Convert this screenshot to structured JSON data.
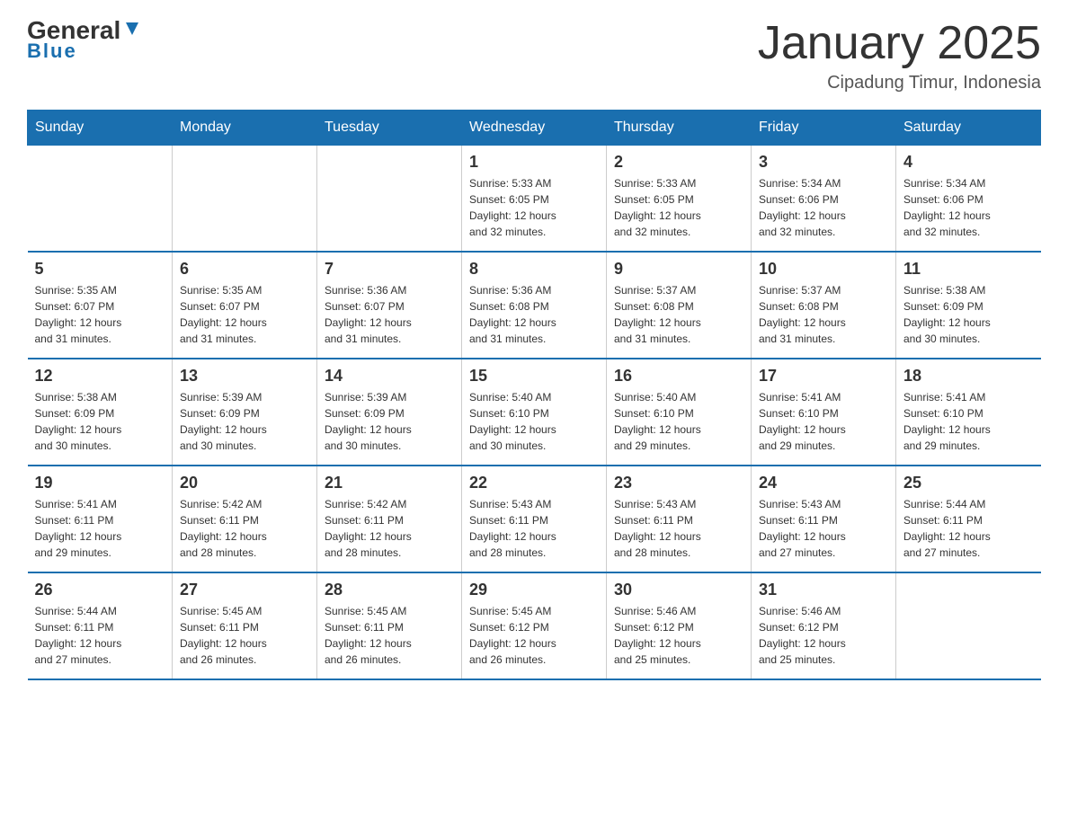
{
  "header": {
    "logo_general": "General",
    "logo_blue": "Blue",
    "title": "January 2025",
    "location": "Cipadung Timur, Indonesia"
  },
  "days_of_week": [
    "Sunday",
    "Monday",
    "Tuesday",
    "Wednesday",
    "Thursday",
    "Friday",
    "Saturday"
  ],
  "weeks": [
    [
      {
        "day": "",
        "info": ""
      },
      {
        "day": "",
        "info": ""
      },
      {
        "day": "",
        "info": ""
      },
      {
        "day": "1",
        "info": "Sunrise: 5:33 AM\nSunset: 6:05 PM\nDaylight: 12 hours\nand 32 minutes."
      },
      {
        "day": "2",
        "info": "Sunrise: 5:33 AM\nSunset: 6:05 PM\nDaylight: 12 hours\nand 32 minutes."
      },
      {
        "day": "3",
        "info": "Sunrise: 5:34 AM\nSunset: 6:06 PM\nDaylight: 12 hours\nand 32 minutes."
      },
      {
        "day": "4",
        "info": "Sunrise: 5:34 AM\nSunset: 6:06 PM\nDaylight: 12 hours\nand 32 minutes."
      }
    ],
    [
      {
        "day": "5",
        "info": "Sunrise: 5:35 AM\nSunset: 6:07 PM\nDaylight: 12 hours\nand 31 minutes."
      },
      {
        "day": "6",
        "info": "Sunrise: 5:35 AM\nSunset: 6:07 PM\nDaylight: 12 hours\nand 31 minutes."
      },
      {
        "day": "7",
        "info": "Sunrise: 5:36 AM\nSunset: 6:07 PM\nDaylight: 12 hours\nand 31 minutes."
      },
      {
        "day": "8",
        "info": "Sunrise: 5:36 AM\nSunset: 6:08 PM\nDaylight: 12 hours\nand 31 minutes."
      },
      {
        "day": "9",
        "info": "Sunrise: 5:37 AM\nSunset: 6:08 PM\nDaylight: 12 hours\nand 31 minutes."
      },
      {
        "day": "10",
        "info": "Sunrise: 5:37 AM\nSunset: 6:08 PM\nDaylight: 12 hours\nand 31 minutes."
      },
      {
        "day": "11",
        "info": "Sunrise: 5:38 AM\nSunset: 6:09 PM\nDaylight: 12 hours\nand 30 minutes."
      }
    ],
    [
      {
        "day": "12",
        "info": "Sunrise: 5:38 AM\nSunset: 6:09 PM\nDaylight: 12 hours\nand 30 minutes."
      },
      {
        "day": "13",
        "info": "Sunrise: 5:39 AM\nSunset: 6:09 PM\nDaylight: 12 hours\nand 30 minutes."
      },
      {
        "day": "14",
        "info": "Sunrise: 5:39 AM\nSunset: 6:09 PM\nDaylight: 12 hours\nand 30 minutes."
      },
      {
        "day": "15",
        "info": "Sunrise: 5:40 AM\nSunset: 6:10 PM\nDaylight: 12 hours\nand 30 minutes."
      },
      {
        "day": "16",
        "info": "Sunrise: 5:40 AM\nSunset: 6:10 PM\nDaylight: 12 hours\nand 29 minutes."
      },
      {
        "day": "17",
        "info": "Sunrise: 5:41 AM\nSunset: 6:10 PM\nDaylight: 12 hours\nand 29 minutes."
      },
      {
        "day": "18",
        "info": "Sunrise: 5:41 AM\nSunset: 6:10 PM\nDaylight: 12 hours\nand 29 minutes."
      }
    ],
    [
      {
        "day": "19",
        "info": "Sunrise: 5:41 AM\nSunset: 6:11 PM\nDaylight: 12 hours\nand 29 minutes."
      },
      {
        "day": "20",
        "info": "Sunrise: 5:42 AM\nSunset: 6:11 PM\nDaylight: 12 hours\nand 28 minutes."
      },
      {
        "day": "21",
        "info": "Sunrise: 5:42 AM\nSunset: 6:11 PM\nDaylight: 12 hours\nand 28 minutes."
      },
      {
        "day": "22",
        "info": "Sunrise: 5:43 AM\nSunset: 6:11 PM\nDaylight: 12 hours\nand 28 minutes."
      },
      {
        "day": "23",
        "info": "Sunrise: 5:43 AM\nSunset: 6:11 PM\nDaylight: 12 hours\nand 28 minutes."
      },
      {
        "day": "24",
        "info": "Sunrise: 5:43 AM\nSunset: 6:11 PM\nDaylight: 12 hours\nand 27 minutes."
      },
      {
        "day": "25",
        "info": "Sunrise: 5:44 AM\nSunset: 6:11 PM\nDaylight: 12 hours\nand 27 minutes."
      }
    ],
    [
      {
        "day": "26",
        "info": "Sunrise: 5:44 AM\nSunset: 6:11 PM\nDaylight: 12 hours\nand 27 minutes."
      },
      {
        "day": "27",
        "info": "Sunrise: 5:45 AM\nSunset: 6:11 PM\nDaylight: 12 hours\nand 26 minutes."
      },
      {
        "day": "28",
        "info": "Sunrise: 5:45 AM\nSunset: 6:11 PM\nDaylight: 12 hours\nand 26 minutes."
      },
      {
        "day": "29",
        "info": "Sunrise: 5:45 AM\nSunset: 6:12 PM\nDaylight: 12 hours\nand 26 minutes."
      },
      {
        "day": "30",
        "info": "Sunrise: 5:46 AM\nSunset: 6:12 PM\nDaylight: 12 hours\nand 25 minutes."
      },
      {
        "day": "31",
        "info": "Sunrise: 5:46 AM\nSunset: 6:12 PM\nDaylight: 12 hours\nand 25 minutes."
      },
      {
        "day": "",
        "info": ""
      }
    ]
  ]
}
